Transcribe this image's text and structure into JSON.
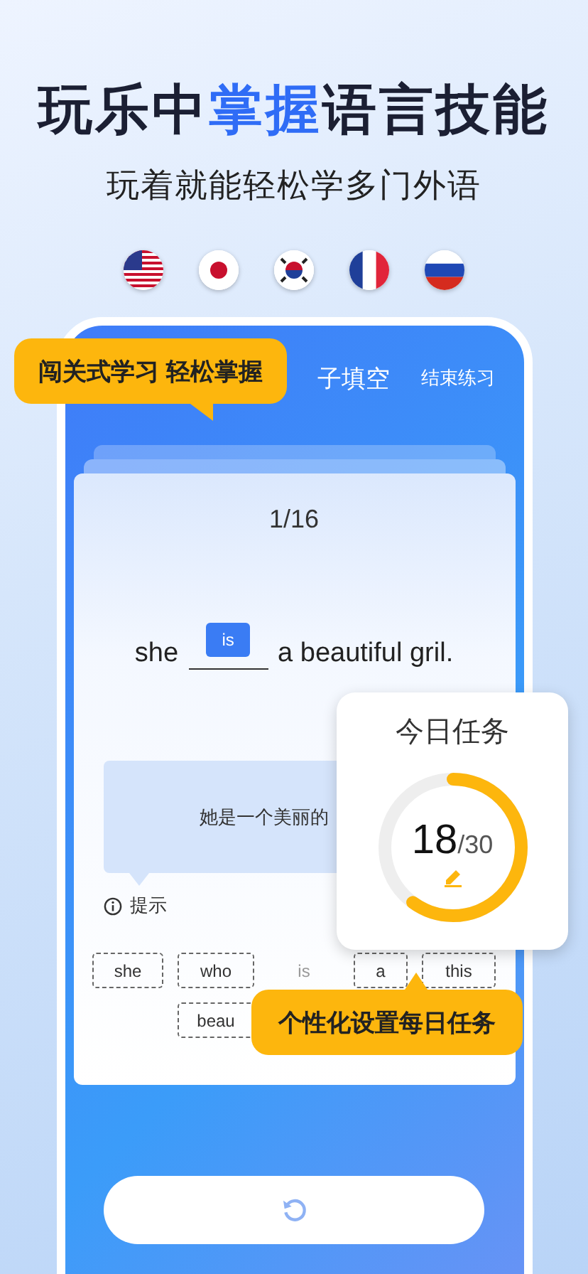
{
  "headline": [
    {
      "text": "玩乐中",
      "highlight": false
    },
    {
      "text": "掌握",
      "highlight": true
    },
    {
      "text": "语言技能",
      "highlight": false
    }
  ],
  "subtitle": "玩着就能轻松学多门外语",
  "flags": [
    {
      "kind": "us"
    },
    {
      "kind": "jp"
    },
    {
      "kind": "kr"
    },
    {
      "kind": "fr"
    },
    {
      "kind": "ru"
    }
  ],
  "phone": {
    "title": "子填空",
    "end_button": "结束练习",
    "card": {
      "progress": "1/16",
      "sentence_before": "she",
      "answer": "is",
      "sentence_after": "a beautiful gril.",
      "translation": "她是一个美丽的",
      "hint": "提示",
      "words": [
        {
          "text": "she",
          "used": false
        },
        {
          "text": "who",
          "used": false
        },
        {
          "text": "is",
          "used": true
        },
        {
          "text": "a",
          "used": false
        },
        {
          "text": "this",
          "used": false
        },
        {
          "text": "beau",
          "used": false
        }
      ]
    }
  },
  "callouts": [
    "闯关式学习 轻松掌握",
    "个性化设置每日任务"
  ],
  "task_card": {
    "title": "今日任务",
    "done": "18",
    "total": "/30",
    "level": 0.6
  }
}
